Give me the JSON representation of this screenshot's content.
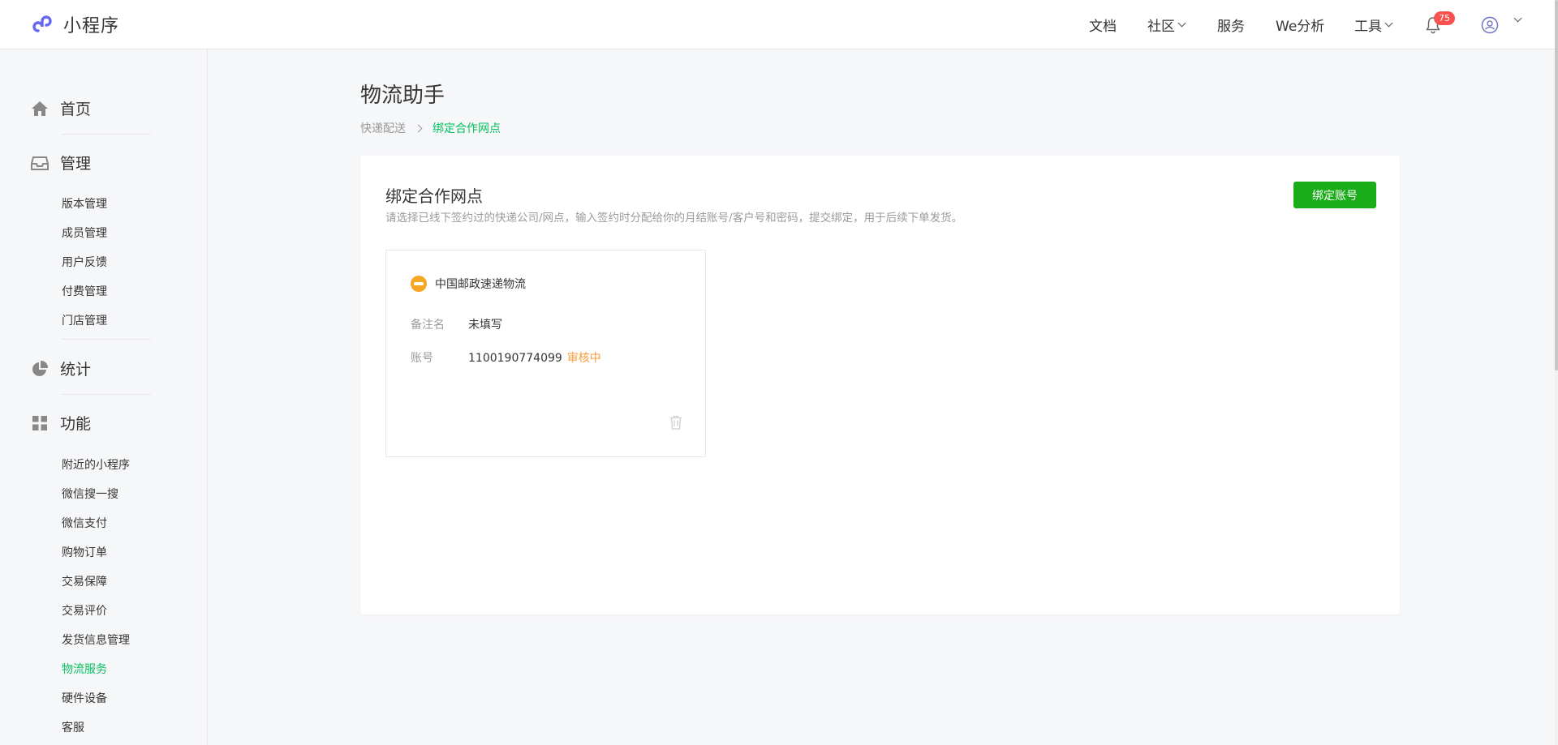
{
  "app": {
    "name": "小程序"
  },
  "nav": {
    "items": [
      {
        "label": "文档",
        "has_dropdown": false
      },
      {
        "label": "社区",
        "has_dropdown": true
      },
      {
        "label": "服务",
        "has_dropdown": false
      },
      {
        "label": "We分析",
        "has_dropdown": false
      },
      {
        "label": "工具",
        "has_dropdown": true
      }
    ],
    "notification_count": "75",
    "icons": [
      "bell-icon",
      "avatar-icon",
      "chevron-down-icon"
    ]
  },
  "sidebar": {
    "home": "首页",
    "manage": "管理",
    "manage_items": [
      "版本管理",
      "成员管理",
      "用户反馈",
      "付费管理",
      "门店管理"
    ],
    "stats": "统计",
    "features": "功能",
    "feature_items": [
      "附近的小程序",
      "微信搜一搜",
      "微信支付",
      "购物订单",
      "交易保障",
      "交易评价",
      "发货信息管理",
      "物流服务",
      "硬件设备",
      "客服"
    ],
    "active_item": "物流服务"
  },
  "page": {
    "title": "物流助手",
    "breadcrumb": [
      "快递配送",
      "绑定合作网点"
    ]
  },
  "panel": {
    "title": "绑定合作网点",
    "description": "请选择已线下签约过的快递公司/网点，输入签约时分配给你的月结账号/客户号和密码，提交绑定，用于后续下单发货。",
    "bind_button": "绑定账号"
  },
  "card": {
    "company": "中国邮政速递物流",
    "remark_label": "备注名",
    "remark_value": "未填写",
    "account_label": "账号",
    "account_value": "1100190774099",
    "status": "审核中"
  },
  "colors": {
    "brand_green": "#07c160",
    "button_green": "#1aad19",
    "status_orange": "#fa9d3b",
    "badge_red": "#fa5151"
  }
}
